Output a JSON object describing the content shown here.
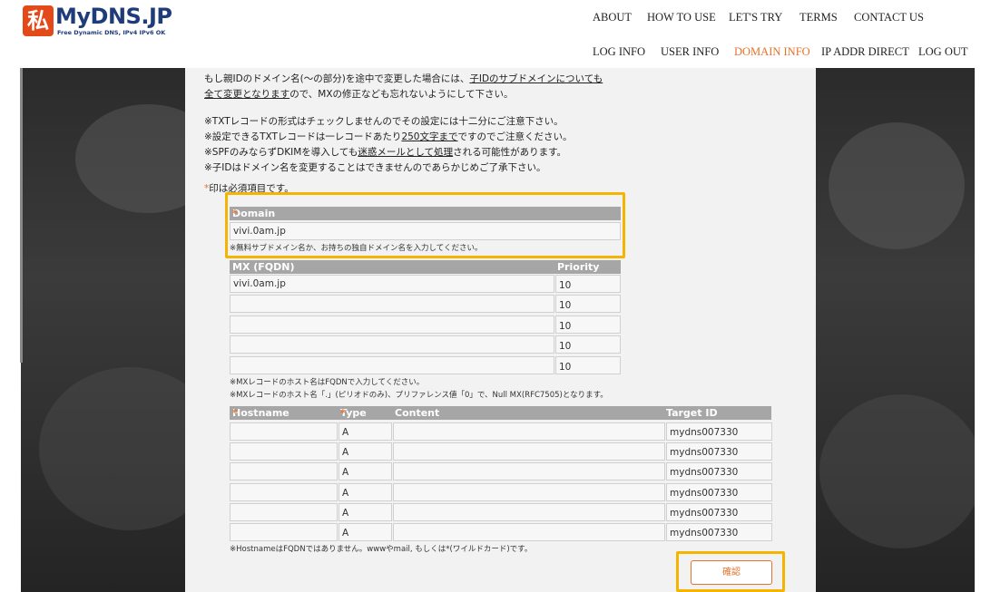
{
  "header": {
    "logo_mark": "私",
    "logo_name": "MyDNS.JP",
    "logo_sub": "Free Dynamic DNS, IPv4 IPv6 OK",
    "nav_top": [
      "ABOUT",
      "HOW TO USE",
      "LET'S TRY",
      "TERMS",
      "CONTACT US"
    ],
    "nav_bottom": [
      "LOG INFO",
      "USER INFO",
      "DOMAIN INFO",
      "IP ADDR DIRECT",
      "LOG OUT"
    ],
    "active_nav": "DOMAIN INFO"
  },
  "notes": {
    "line1_a": "もし親IDのドメイン名(〜の部分)を途中で変更した場合には、",
    "line1_u": "子IDのサブドメインについても",
    "line2_u": "全て変更となります",
    "line2_b": "ので、MXの修正なども忘れないようにして下さい。",
    "txt1": "※TXTレコードの形式はチェックしませんのでその設定には十二分にご注意下さい。",
    "txt2_a": "※設定できるTXTレコードは一レコードあたり",
    "txt2_u": "250文字まで",
    "txt2_b": "ですのでご注意ください。",
    "txt3_a": "※SPFのみならずDKIMを導入しても",
    "txt3_u": "迷惑メールとして処理",
    "txt3_b": "される可能性があります。",
    "txt4": "※子IDはドメイン名を変更することはできませんのであらかじめご了承下さい。",
    "required_mark": "*",
    "required_text": "印は必須項目です。"
  },
  "domain": {
    "label": "Domain",
    "value": "vivi.0am.jp",
    "help": "※無料サブドメイン名か、お持ちの独自ドメイン名を入力してください。"
  },
  "mx": {
    "col_fqdn": "MX (FQDN)",
    "col_priority": "Priority",
    "rows": [
      {
        "fqdn": "vivi.0am.jp",
        "priority": "10"
      },
      {
        "fqdn": "",
        "priority": "10"
      },
      {
        "fqdn": "",
        "priority": "10"
      },
      {
        "fqdn": "",
        "priority": "10"
      },
      {
        "fqdn": "",
        "priority": "10"
      }
    ],
    "note1": "※MXレコードのホスト名はFQDNで入力してください。",
    "note2": "※MXレコードのホスト名「.」(ピリオドのみ)、プリファレンス値「0」で、Null MX(RFC7505)となります。"
  },
  "records": {
    "col_hostname": "Hostname",
    "col_type": "Type",
    "col_content": "Content",
    "col_target": "Target ID",
    "rows": [
      {
        "hostname": "",
        "type": "A",
        "content": "",
        "target": "mydns007330"
      },
      {
        "hostname": "",
        "type": "A",
        "content": "",
        "target": "mydns007330"
      },
      {
        "hostname": "",
        "type": "A",
        "content": "",
        "target": "mydns007330"
      },
      {
        "hostname": "",
        "type": "A",
        "content": "",
        "target": "mydns007330"
      },
      {
        "hostname": "",
        "type": "A",
        "content": "",
        "target": "mydns007330"
      },
      {
        "hostname": "",
        "type": "A",
        "content": "",
        "target": "mydns007330"
      }
    ],
    "note": "※HostnameはFQDNではありません。wwwやmail, もしくは*(ワイルドカード)です。"
  },
  "confirm_label": "確認",
  "colors": {
    "accent": "#e4722a",
    "highlight": "#f5b400",
    "header_cell": "#a6a6a6",
    "brand_blue": "#1f3c7a"
  }
}
